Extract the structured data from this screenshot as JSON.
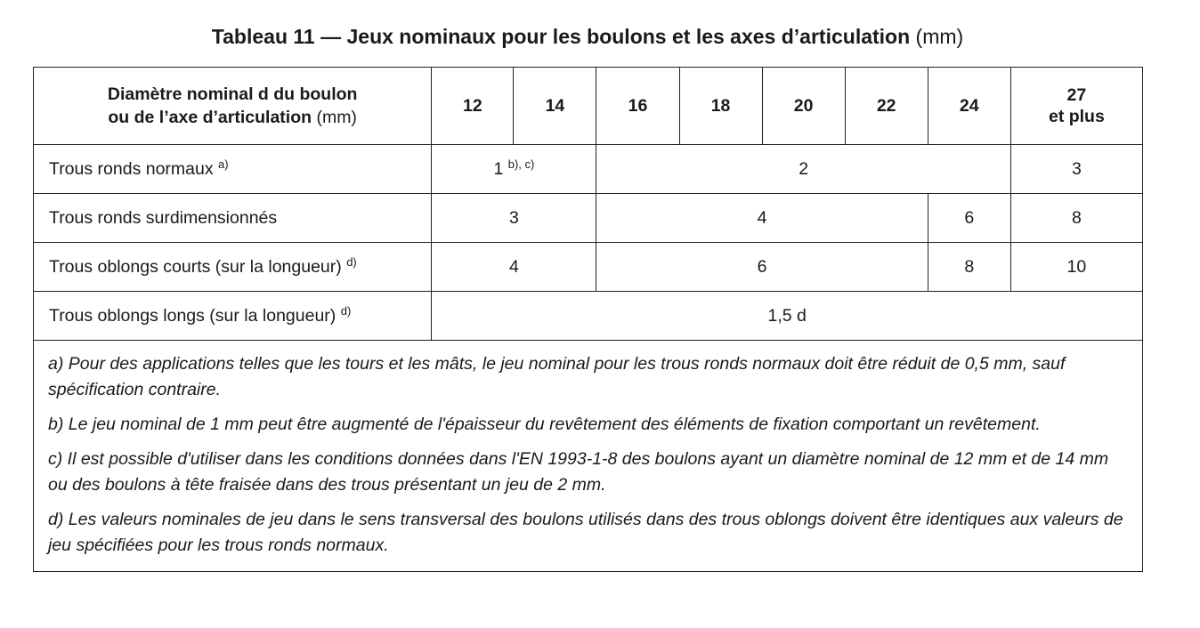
{
  "title": {
    "main": "Tableau 11 — Jeux nominaux pour les boulons et les axes d’articulation",
    "unit": "(mm)"
  },
  "header": {
    "label_line1": "Diamètre nominal d du boulon",
    "label_line2_bold": "ou de l’axe d’articulation",
    "label_line2_unit": "(mm)",
    "diameters": [
      "12",
      "14",
      "16",
      "18",
      "20",
      "22",
      "24"
    ],
    "last_line1": "27",
    "last_line2": "et plus"
  },
  "rows": [
    {
      "label": "Trous ronds normaux",
      "label_note": "a)",
      "cells": [
        {
          "value": "1",
          "note": "b), c)"
        },
        {
          "value": "2",
          "note": ""
        },
        {
          "value": "3",
          "note": ""
        }
      ]
    },
    {
      "label": "Trous ronds surdimensionnés",
      "label_note": "",
      "cells": [
        {
          "value": "3"
        },
        {
          "value": "4"
        },
        {
          "value": "6"
        },
        {
          "value": "8"
        }
      ]
    },
    {
      "label": "Trous oblongs courts (sur la longueur)",
      "label_note": "d)",
      "cells": [
        {
          "value": "4"
        },
        {
          "value": "6"
        },
        {
          "value": "8"
        },
        {
          "value": "10"
        }
      ]
    },
    {
      "label": "Trous oblongs longs (sur la longueur)",
      "label_note": "d)",
      "cells": [
        {
          "value": "1,5 d"
        }
      ]
    }
  ],
  "notes": [
    "a) Pour des applications telles que les tours et les mâts, le jeu nominal pour les trous ronds normaux doit être réduit de 0,5 mm, sauf spécification contraire.",
    "b) Le jeu nominal de 1 mm peut être augmenté de l'épaisseur du revêtement des éléments de fixation comportant un revêtement.",
    "c) Il est possible d'utiliser dans les conditions données dans l'EN 1993-1-8 des boulons ayant un diamètre nominal de 12 mm et de 14 mm ou des boulons à tête fraisée dans des trous présentant un jeu de 2 mm.",
    "d) Les valeurs nominales de jeu dans le sens transversal des boulons utilisés dans des trous oblongs doivent être identiques aux valeurs de jeu spécifiées pour les trous ronds normaux."
  ]
}
